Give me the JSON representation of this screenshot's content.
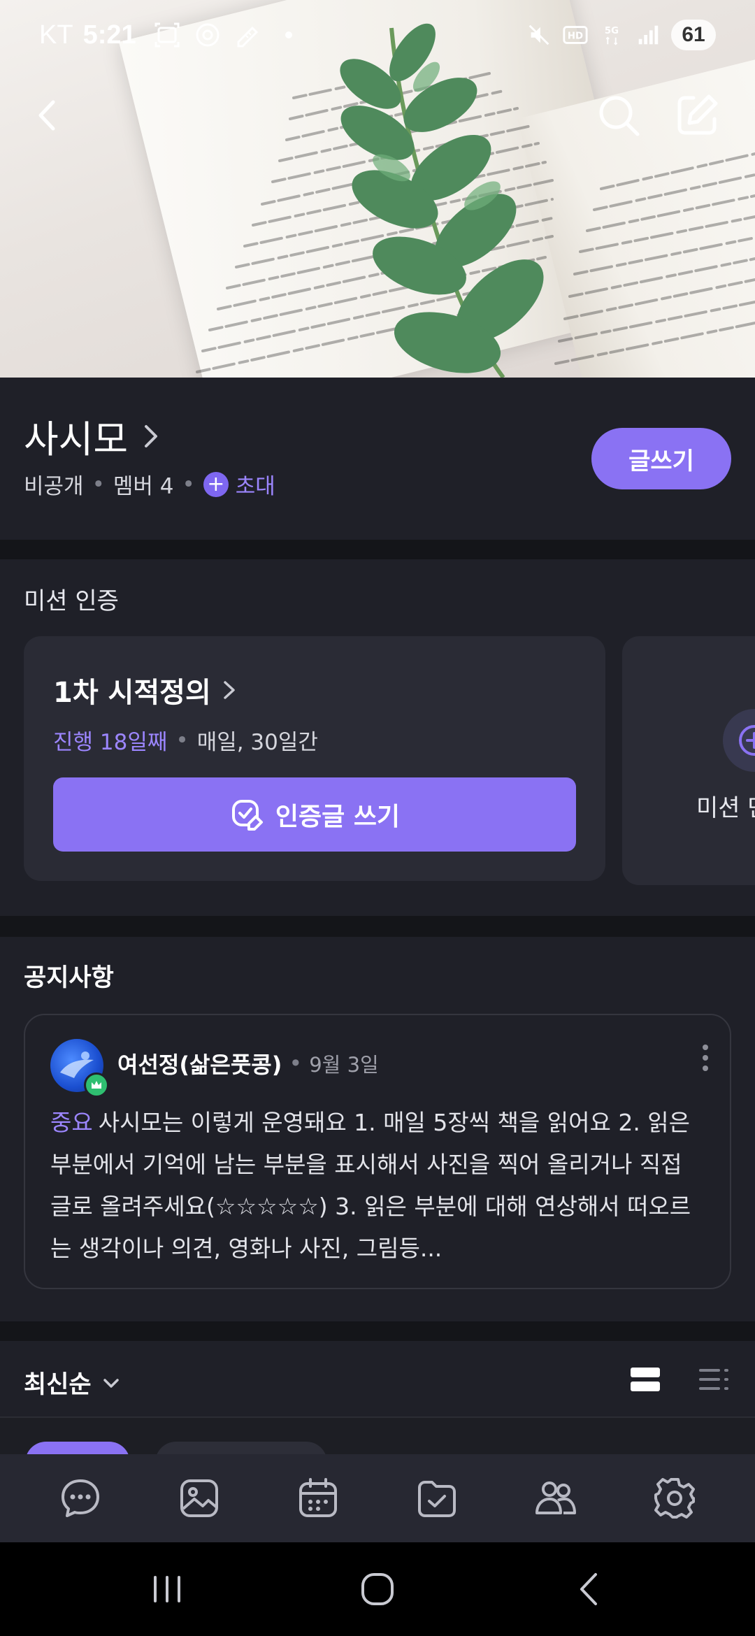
{
  "status_bar": {
    "carrier": "KT",
    "time": "5:21",
    "battery": "61"
  },
  "colors": {
    "accent": "#8a72f3",
    "accent_text": "#9c86ff",
    "background": "#1f2028",
    "card": "#2a2b35",
    "badge_green": "#2fbf71"
  },
  "header": {
    "back_icon": "chevron-left-icon",
    "search_icon": "search-icon",
    "edit_icon": "edit-icon"
  },
  "group": {
    "name": "사시모",
    "visibility": "비공개",
    "members": "멤버 4",
    "invite_label": "초대",
    "write_button": "글쓰기"
  },
  "mission": {
    "section_title": "미션 인증",
    "card": {
      "title": "1차 시적정의",
      "progress": "진행 18일째",
      "schedule": "매일, 30일간",
      "cert_button": "인증글 쓰기"
    },
    "next_card_label": "미션 만들기"
  },
  "notice": {
    "section_title": "공지사항",
    "post": {
      "author": "여선정(삶은풋콩)",
      "date": "9월 3일",
      "tag": "중요",
      "body": "사시모는 이렇게 운영돼요 1. 매일 5장씩 책을 읽어요 2. 읽은 부분에서 기억에 남는 부분을 표시해서 사진을 찍어 올리거나 직접 글로 올려주세요(☆☆☆☆☆) 3. 읽은 부분에 대해 연상해서 떠오르는 생각이나 의견, 영화나 사진, 그림등..."
    }
  },
  "sort": {
    "label": "최신순"
  },
  "tabs": [
    {
      "name": "chat-tab",
      "icon": "chat-bubble-icon"
    },
    {
      "name": "photo-tab",
      "icon": "image-icon"
    },
    {
      "name": "calendar-tab",
      "icon": "calendar-icon"
    },
    {
      "name": "mission-tab",
      "icon": "folder-check-icon"
    },
    {
      "name": "members-tab",
      "icon": "people-icon"
    },
    {
      "name": "settings-tab",
      "icon": "gear-icon"
    }
  ]
}
